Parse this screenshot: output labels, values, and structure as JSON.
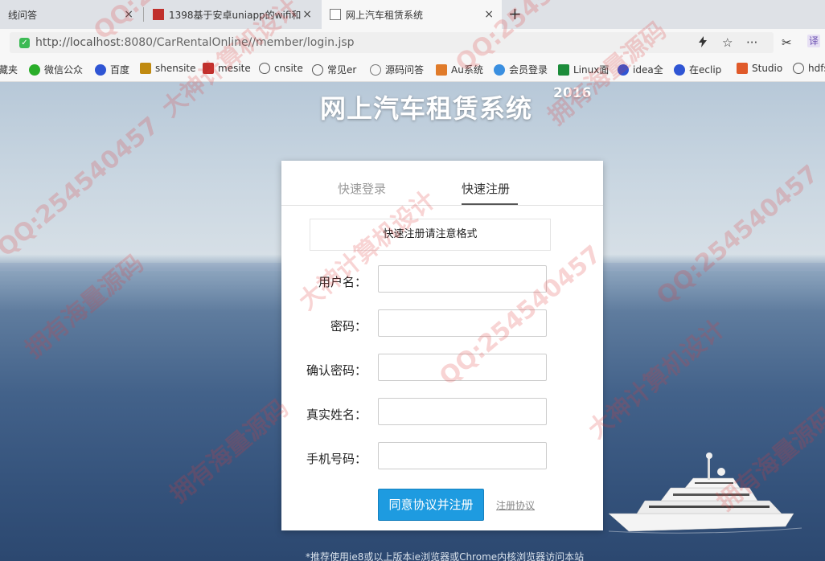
{
  "browser": {
    "tabs": [
      {
        "title": "线问答",
        "active": false
      },
      {
        "title": "1398基于安卓uniapp的wifi和",
        "active": false
      },
      {
        "title": "网上汽车租赁系统",
        "active": true
      }
    ],
    "close_glyph": "×",
    "new_tab_glyph": "+",
    "url_scheme_host": "http://localhost",
    "url_rest": ":8080/CarRentalOnline//member/login.jsp",
    "toolbar_icons": [
      "lightning-icon",
      "star-icon",
      "more-icon",
      "scissors-icon",
      "translate-icon"
    ],
    "translate_label": "译",
    "bookmarks": [
      {
        "label": "藏夹",
        "icon": "folder-icon"
      },
      {
        "label": "微信公众",
        "icon": "wechat-icon"
      },
      {
        "label": "百度",
        "icon": "baidu-icon"
      },
      {
        "label": "shensite",
        "icon": "site-icon"
      },
      {
        "label": "mesite",
        "icon": "site-icon"
      },
      {
        "label": "cnsite",
        "icon": "globe-icon"
      },
      {
        "label": "常见er",
        "icon": "globe-icon"
      },
      {
        "label": "源码问答",
        "icon": "code-icon"
      },
      {
        "label": "Au系统",
        "icon": "au-icon"
      },
      {
        "label": "会员登录",
        "icon": "cloud-icon"
      },
      {
        "label": "Linux面",
        "icon": "shield-icon"
      },
      {
        "label": "idea全",
        "icon": "baidu-icon"
      },
      {
        "label": "在eclip",
        "icon": "baidu-icon"
      },
      {
        "label": "Studio",
        "icon": "c-icon"
      },
      {
        "label": "hdfs",
        "icon": "globe-icon"
      }
    ]
  },
  "page": {
    "site_title": "网上汽车租赁系统",
    "site_year": "2016",
    "tab_login": "快速登录",
    "tab_register": "快速注册",
    "notice": "快速注册请注意格式",
    "fields": [
      {
        "label": "用户名：",
        "value": ""
      },
      {
        "label": "密码：",
        "value": ""
      },
      {
        "label": "确认密码：",
        "value": ""
      },
      {
        "label": "真实姓名：",
        "value": ""
      },
      {
        "label": "手机号码：",
        "value": ""
      }
    ],
    "submit_label": "同意协议并注册",
    "agreement_link": "注册协议",
    "footnote": "*推荐使用ie8或以上版本ie浏览器或Chrome内核浏览器访问本站"
  },
  "watermark": {
    "texts": [
      "QQ:254540457",
      "大神计算机设计",
      "拥有海量源码"
    ]
  },
  "colors": {
    "primary_button": "#1e9be0",
    "tab_underline": "#555555",
    "watermark": "#e13c3c"
  }
}
